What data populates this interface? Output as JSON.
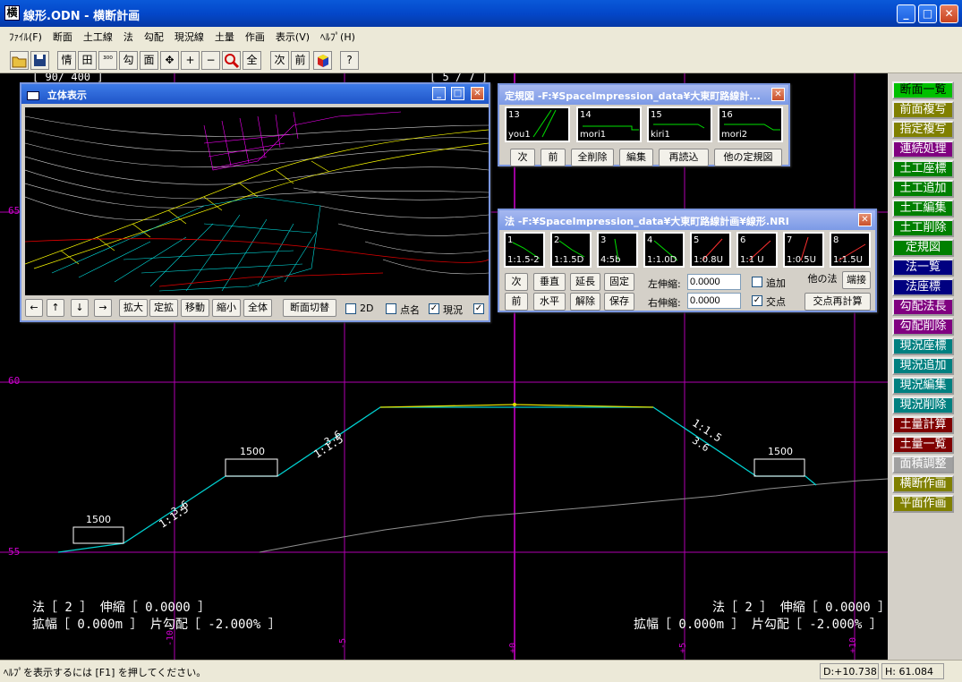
{
  "window": {
    "title": "線形.ODN - 横断計画",
    "icon": "横"
  },
  "menu": [
    "ﾌｧｲﾙ(F)",
    "断面",
    "土工線",
    "法",
    "勾配",
    "現況線",
    "土量",
    "作画",
    "表示(V)",
    "ﾍﾙﾌﾟ(H)"
  ],
  "toolbar": [
    "open-icon",
    "save-icon",
    "情",
    "田",
    "300",
    "勾",
    "面",
    "move-icon",
    "+",
    "−",
    "zoom-icon",
    "全",
    "次",
    "前",
    "cube-icon",
    "?"
  ],
  "toolbar_text": {
    "b2": "情",
    "b3": "田",
    "b4": "³⁰⁰",
    "b5": "勾",
    "b6": "面",
    "b7": "✥",
    "b8": "+",
    "b9": "−",
    "b11": "全",
    "b12": "次",
    "b13": "前",
    "b15": "?"
  },
  "canvas": {
    "top_labels": {
      "l1": "[ 90/ 400 ]",
      "l2": "[ 5 / 7 ]"
    },
    "y_labels": {
      "y65": "65",
      "y60": "60",
      "y55": "55"
    },
    "x_labels": {
      "xm10": "-10",
      "xm5": "-5",
      "x0": "+0",
      "xp5": "+5",
      "xp10": "+10"
    },
    "berm_labels": {
      "b1": "1500",
      "b2": "1500",
      "b3": "1500"
    },
    "slope_labels": {
      "s1a": "1:1.5",
      "s1b": "3.6",
      "s2a": "1:1.5",
      "s2b": "3.6",
      "s3a": "1:1.5",
      "s3b": "3.6"
    },
    "left_info": {
      "line1": "法［ 2 ］ 伸縮［ 0.0000 ］",
      "line2": "拡幅［ 0.000m ］ 片勾配［ -2.000% ］"
    },
    "right_info": {
      "line1": "法［ 2 ］ 伸縮［ 0.0000 ］",
      "line2": "拡幅［ 0.000m ］ 片勾配［ -2.000% ］"
    }
  },
  "win3d": {
    "title": "立体表示",
    "buttons": {
      "left": "←",
      "up": "↑",
      "down": "↓",
      "right": "→",
      "zoom_in": "拡大",
      "fixed_zoom": "定拡",
      "move": "移動",
      "zoom_out": "縮小",
      "all": "全体",
      "switch": "断面切替"
    },
    "checks": {
      "c2d": "2D",
      "names": "点名",
      "current": "現況"
    }
  },
  "std_win": {
    "title": "定規図 -F:¥SpaceImpression_data¥大東町路線計...",
    "thumbs": [
      {
        "n": "13",
        "l": "you1"
      },
      {
        "n": "14",
        "l": "mori1"
      },
      {
        "n": "15",
        "l": "kiri1"
      },
      {
        "n": "16",
        "l": "mori2"
      }
    ],
    "buttons": {
      "next": "次",
      "prev": "前",
      "del_all": "全削除",
      "edit": "編集",
      "reload": "再読込",
      "other": "他の定規図"
    }
  },
  "slope_win": {
    "title": "法 -F:¥SpaceImpression_data¥大東町路線計画¥線形.NRI",
    "thumbs": [
      {
        "n": "1",
        "l": "1:1.5-2"
      },
      {
        "n": "2",
        "l": "1:1.5D"
      },
      {
        "n": "3",
        "l": "4:5b"
      },
      {
        "n": "4",
        "l": "1:1.0D"
      },
      {
        "n": "5",
        "l": "1:0.8U"
      },
      {
        "n": "6",
        "l": "1:1 U"
      },
      {
        "n": "7",
        "l": "1:0.5U"
      },
      {
        "n": "8",
        "l": "1:1.5U"
      }
    ],
    "buttons": {
      "next": "次",
      "prev": "前",
      "vertical": "垂直",
      "horizontal": "水平",
      "extend": "延長",
      "release": "解除",
      "fix": "固定",
      "save": "保存",
      "other_slope": "他の法",
      "edge": "端接",
      "recalc": "交点再計算"
    },
    "left_label": "左伸縮:",
    "right_label": "右伸縮:",
    "left_value": "0.0000",
    "right_value": "0.0000",
    "add_label": "追加",
    "cross_label": "交点"
  },
  "right_buttons": [
    {
      "label": "断面一覧",
      "bg": "#00c000",
      "fg": "#000"
    },
    {
      "label": "前面複写",
      "bg": "#808000",
      "fg": "#fff"
    },
    {
      "label": "指定複写",
      "bg": "#808000",
      "fg": "#fff"
    },
    {
      "label": "連続処理",
      "bg": "#800080",
      "fg": "#fff"
    },
    {
      "label": "土工座標",
      "bg": "#008000",
      "fg": "#fff"
    },
    {
      "label": "土工追加",
      "bg": "#008000",
      "fg": "#fff"
    },
    {
      "label": "土工編集",
      "bg": "#008000",
      "fg": "#fff"
    },
    {
      "label": "土工削除",
      "bg": "#008000",
      "fg": "#fff"
    },
    {
      "label": "定規図",
      "bg": "#008000",
      "fg": "#fff"
    },
    {
      "label": "法一覧",
      "bg": "#000080",
      "fg": "#fff"
    },
    {
      "label": "法座標",
      "bg": "#000080",
      "fg": "#fff"
    },
    {
      "label": "勾配法長",
      "bg": "#800080",
      "fg": "#fff"
    },
    {
      "label": "勾配削除",
      "bg": "#800080",
      "fg": "#fff"
    },
    {
      "label": "現況座標",
      "bg": "#008080",
      "fg": "#fff"
    },
    {
      "label": "現況追加",
      "bg": "#008080",
      "fg": "#fff"
    },
    {
      "label": "現況編集",
      "bg": "#008080",
      "fg": "#fff"
    },
    {
      "label": "現況削除",
      "bg": "#008080",
      "fg": "#fff"
    },
    {
      "label": "土量計算",
      "bg": "#800000",
      "fg": "#fff"
    },
    {
      "label": "土量一覧",
      "bg": "#800000",
      "fg": "#fff"
    },
    {
      "label": "面積調整",
      "bg": "#a0a0a0",
      "fg": "#fff"
    },
    {
      "label": "横断作画",
      "bg": "#808000",
      "fg": "#fff"
    },
    {
      "label": "平面作画",
      "bg": "#808000",
      "fg": "#fff"
    }
  ],
  "rb": {
    "b0": "断面一覧",
    "b1": "前面複写",
    "b2": "指定複写",
    "b3": "連続処理",
    "b4": "土工座標",
    "b5": "土工追加",
    "b6": "土工編集",
    "b7": "土工削除",
    "b8": "定規図",
    "b9": "法一覧",
    "b10": "法座標",
    "b11": "勾配法長",
    "b12": "勾配削除",
    "b13": "現況座標",
    "b14": "現況追加",
    "b15": "現況編集",
    "b16": "現況削除",
    "b17": "土量計算",
    "b18": "土量一覧",
    "b19": "面積調整",
    "b20": "横断作画",
    "b21": "平面作画"
  },
  "status": {
    "help": "ﾍﾙﾌﾟを表示するには [F1] を押してください。",
    "d": "D:+10.738",
    "h": "H: 61.084"
  }
}
